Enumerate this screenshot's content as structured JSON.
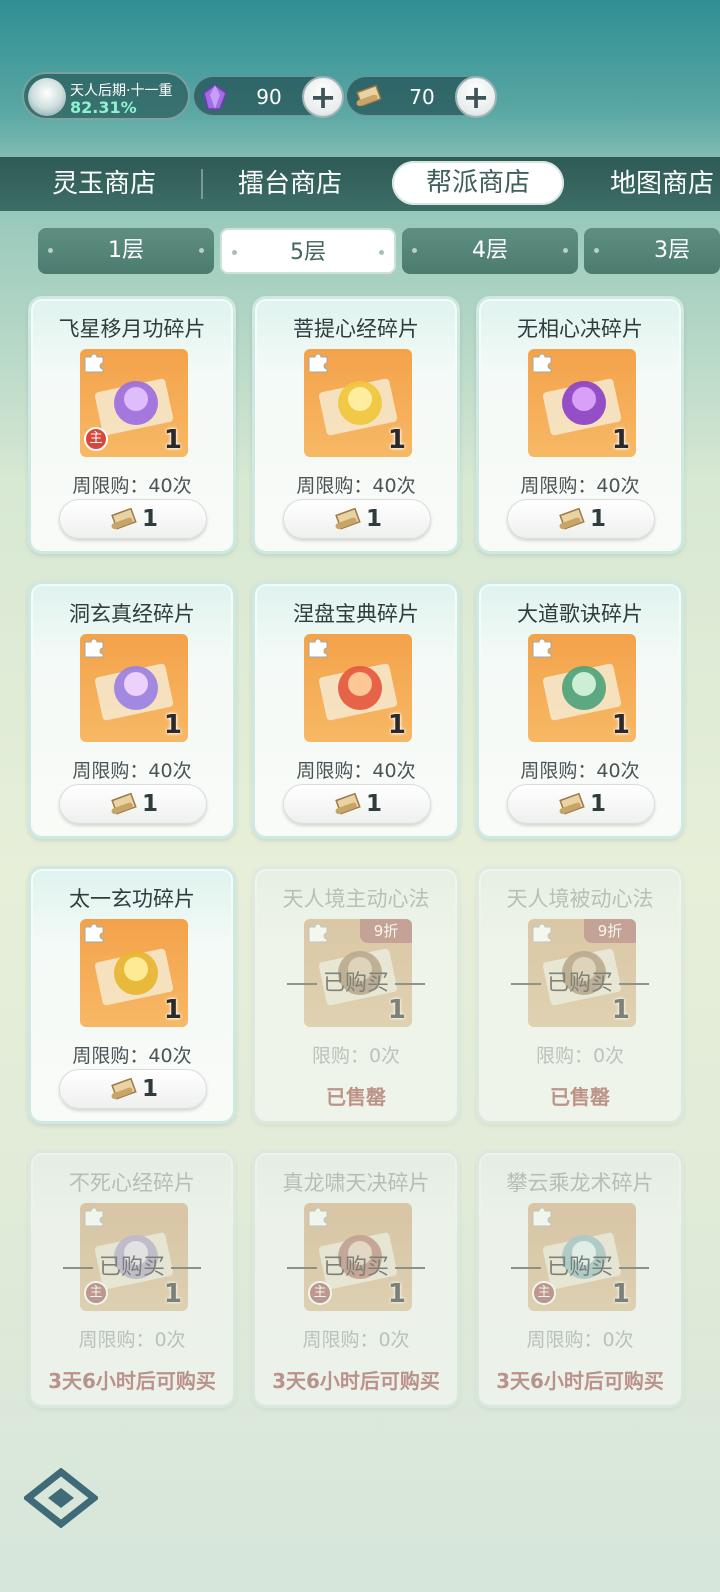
{
  "header": {
    "realm": {
      "name": "天人后期·十一重",
      "progress": "82.31%"
    },
    "currencies": [
      {
        "icon": "purple-crystal-icon",
        "value": "90"
      },
      {
        "icon": "scroll-token-icon",
        "value": "70"
      }
    ],
    "plus_label": "+"
  },
  "shop_tabs": [
    {
      "label": "灵玉商店"
    },
    {
      "label": "擂台商店"
    },
    {
      "label": "帮派商店",
      "active": true
    },
    {
      "label": "地图商店"
    }
  ],
  "floor_tabs": [
    {
      "label": "1层"
    },
    {
      "label": "5层",
      "active": true
    },
    {
      "label": "4层"
    },
    {
      "label": "3层"
    }
  ],
  "items": [
    {
      "title": "飞星移月功碎片",
      "qty": "1",
      "main": "主",
      "limit": "周限购：40次",
      "price": "1",
      "state": "available",
      "art": "purple"
    },
    {
      "title": "菩提心经碎片",
      "qty": "1",
      "limit": "周限购：40次",
      "price": "1",
      "state": "available",
      "art": "gold"
    },
    {
      "title": "无相心决碎片",
      "qty": "1",
      "limit": "周限购：40次",
      "price": "1",
      "state": "available",
      "art": "violet"
    },
    {
      "title": "洞玄真经碎片",
      "qty": "1",
      "limit": "周限购：40次",
      "price": "1",
      "state": "available",
      "art": "swirl"
    },
    {
      "title": "涅盘宝典碎片",
      "qty": "1",
      "limit": "周限购：40次",
      "price": "1",
      "state": "available",
      "art": "red"
    },
    {
      "title": "大道歌诀碎片",
      "qty": "1",
      "limit": "周限购：40次",
      "price": "1",
      "state": "available",
      "art": "green"
    },
    {
      "title": "太一玄功碎片",
      "qty": "1",
      "limit": "周限购：40次",
      "price": "1",
      "state": "available",
      "art": "dragon"
    },
    {
      "title": "天人境主动心法",
      "qty": "1",
      "discount": "9折",
      "bought": "已购买",
      "limit": "限购：0次",
      "status": "已售罄",
      "state": "soldout",
      "art": "chest"
    },
    {
      "title": "天人境被动心法",
      "qty": "1",
      "discount": "9折",
      "bought": "已购买",
      "limit": "限购：0次",
      "status": "已售罄",
      "state": "soldout",
      "art": "chest"
    },
    {
      "title": "不死心经碎片",
      "qty": "1",
      "main": "主",
      "bought": "已购买",
      "limit": "周限购：0次",
      "status": "3天6小时后可购买",
      "state": "cooldown",
      "art": "lotus"
    },
    {
      "title": "真龙啸天决碎片",
      "qty": "1",
      "main": "主",
      "bought": "已购买",
      "limit": "周限购：0次",
      "status": "3天6小时后可购买",
      "state": "cooldown",
      "art": "red"
    },
    {
      "title": "攀云乘龙术碎片",
      "qty": "1",
      "main": "主",
      "bought": "已购买",
      "limit": "周限购：0次",
      "status": "3天6小时后可购买",
      "state": "cooldown",
      "art": "cyan"
    }
  ],
  "colors": {
    "accent": "#3c6e66",
    "sold_red": "#e03b32",
    "item_bg": "#f4a24a"
  },
  "footer": {
    "icon": "game-logo-icon"
  }
}
